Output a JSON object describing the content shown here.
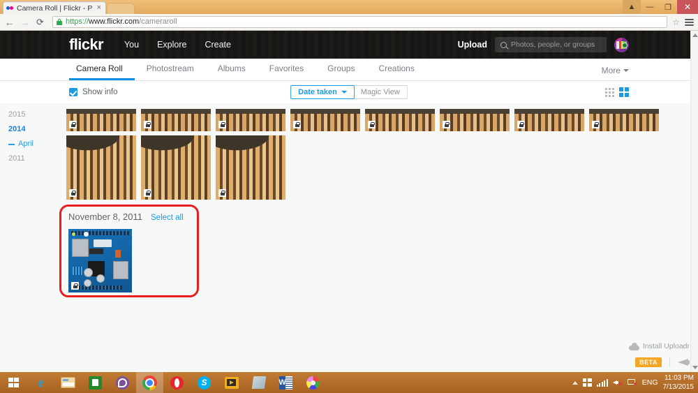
{
  "browser": {
    "tab_title": "Camera Roll | Flickr - Phot",
    "tab_close": "×",
    "back_icon": "←",
    "forward_icon": "→",
    "reload_icon": "⟳",
    "url_scheme": "https://",
    "url_host": "www.flickr.com",
    "url_path": "/cameraroll",
    "star_icon": "☆",
    "minimize_label": "—",
    "maximize_label": "❐",
    "close_label": "✕",
    "user_icon": "▲"
  },
  "flickr_header": {
    "logo": "flickr",
    "nav": [
      {
        "label": "You"
      },
      {
        "label": "Explore"
      },
      {
        "label": "Create"
      }
    ],
    "upload_label": "Upload",
    "search_placeholder": "Photos, people, or groups",
    "search_value": "",
    "accent_color": "#0f8fe0"
  },
  "subnav": {
    "tabs": [
      {
        "label": "Camera Roll",
        "active": true
      },
      {
        "label": "Photostream",
        "active": false
      },
      {
        "label": "Albums",
        "active": false
      },
      {
        "label": "Favorites",
        "active": false
      },
      {
        "label": "Groups",
        "active": false
      },
      {
        "label": "Creations",
        "active": false
      }
    ],
    "more_label": "More"
  },
  "toolbar": {
    "show_info_label": "Show info",
    "show_info_checked": true,
    "sort_label": "Date taken",
    "magic_view_label": "Magic View",
    "view_small_icon": "grid-9-dots",
    "view_large_icon": "grid-4-squares",
    "active_view": "grid-4-squares"
  },
  "sidebar": {
    "items": [
      {
        "label": "2015",
        "type": "year",
        "active": false
      },
      {
        "label": "2014",
        "type": "year",
        "active": true
      },
      {
        "label": "April",
        "type": "month",
        "active": true
      },
      {
        "label": "2011",
        "type": "year",
        "active": false
      }
    ]
  },
  "photo_grid": {
    "row_top_count": 8,
    "row_second_count": 3,
    "thumb_alt": "Colosseum",
    "privacy_badge": "lock-icon"
  },
  "date_group": {
    "date": "November 8, 2011",
    "select_all_label": "Select all",
    "photo_alt": "Arduino board",
    "highlight_color": "#e81d1d"
  },
  "footer": {
    "install_label": "Install Uploadr",
    "beta_label": "BETA",
    "feedback_icon": "megaphone-icon"
  },
  "taskbar": {
    "items": [
      {
        "name": "start-button",
        "glyph": "g-start",
        "active": false
      },
      {
        "name": "internet-explorer",
        "glyph": "g-ie",
        "active": false
      },
      {
        "name": "file-explorer",
        "glyph": "g-folder",
        "active": false
      },
      {
        "name": "windows-store",
        "glyph": "g-store",
        "active": false
      },
      {
        "name": "viber",
        "glyph": "g-viber",
        "active": false
      },
      {
        "name": "google-chrome",
        "glyph": "g-chrome",
        "active": true
      },
      {
        "name": "opera",
        "glyph": "g-opera",
        "active": false
      },
      {
        "name": "skype",
        "glyph": "g-skype",
        "active": false
      },
      {
        "name": "media-player",
        "glyph": "g-media",
        "active": false
      },
      {
        "name": "onenote",
        "glyph": "g-note",
        "active": false
      },
      {
        "name": "microsoft-word",
        "glyph": "g-word",
        "active": false
      },
      {
        "name": "paint",
        "glyph": "g-paint",
        "active": false
      }
    ],
    "skype_letter": "S",
    "word_letter": "W",
    "language": "ENG",
    "time": "11:03 PM",
    "date": "7/13/2015"
  }
}
